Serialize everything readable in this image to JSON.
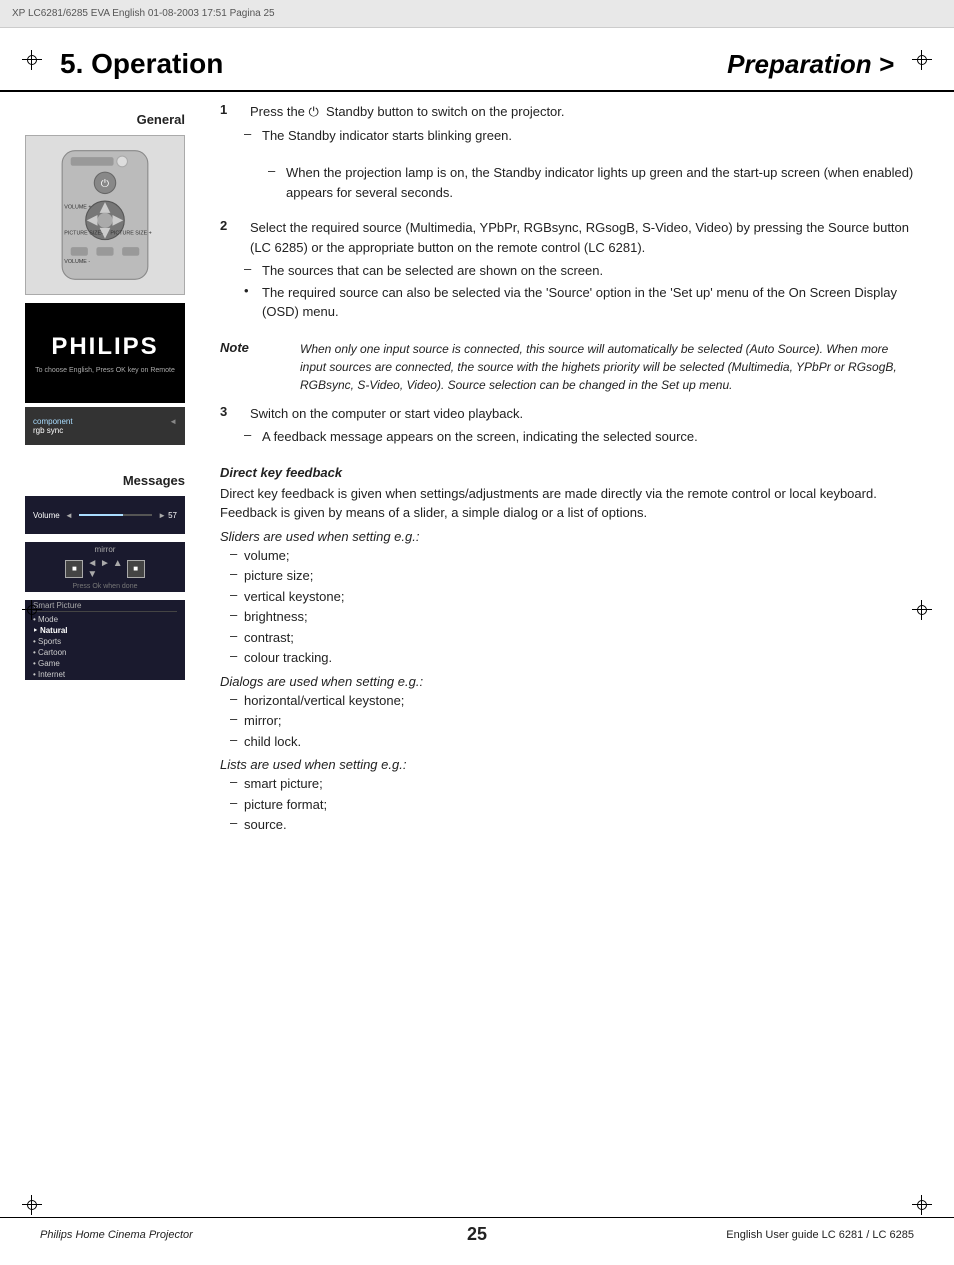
{
  "header": {
    "meta_text": "XP LC6281/6285 EVA English 01-08-2003  17:51  Pagina 25"
  },
  "title": {
    "chapter": "5. Operation",
    "section": "Preparation >"
  },
  "sidebar": {
    "general_label": "General",
    "philips_logo": "PHILIPS",
    "philips_subtitle": "To choose English, Press OK key on Remote",
    "messages_label": "Messages",
    "slider_label": "Volume",
    "slider_value": "57"
  },
  "content": {
    "step1": {
      "number": "1",
      "text": "Press the ⏻  Standby button to switch on the projector.",
      "dash1": "The Standby indicator starts blinking green."
    },
    "note_spacer": "When the projection lamp is on, the Standby indicator lights up green and the start-up screen (when enabled) appears for several seconds.",
    "step2": {
      "number": "2",
      "text": "Select the required source (Multimedia, YPbPr, RGBsync, RGsogB, S-Video, Video) by pressing the Source button (LC 6285) or the appropriate button on the remote control (LC 6281).",
      "dash1": "The sources that can be selected are shown on the screen.",
      "bullet1": "The required source can also be selected via the 'Source' option in the 'Set up' menu of the On Screen Display (OSD) menu."
    },
    "note": {
      "label": "Note",
      "text": "When only one input source is connected, this source will automatically be selected (Auto Source). When more input sources are connected, the source with the highets priority will be selected (Multimedia, YPbPr or RGsogB, RGBsync, S-Video, Video). Source selection can be changed in the Set up menu."
    },
    "step3": {
      "number": "3",
      "text": "Switch on the computer or start video playback.",
      "dash1": "A feedback message appears on the screen, indicating the selected source."
    },
    "messages_heading": "Direct key feedback",
    "messages_intro": "Direct key feedback is given when settings/adjustments are made directly via the remote control or local keyboard. Feedback is given by means of a slider, a simple dialog or a list of options.",
    "sliders_intro": "Sliders are used when setting e.g.:",
    "sliders": [
      "volume;",
      "picture size;",
      "vertical keystone;",
      "brightness;",
      "contrast;",
      "colour tracking."
    ],
    "dialogs_intro": "Dialogs are used when setting e.g.:",
    "dialogs": [
      "horizontal/vertical keystone;",
      "mirror;",
      "child lock."
    ],
    "lists_intro": "Lists are used when setting e.g.:",
    "lists": [
      "smart picture;",
      "picture format;",
      "source."
    ]
  },
  "footer": {
    "left": "Philips Home Cinema Projector",
    "center": "25",
    "right": "English  User guide   LC 6281 / LC 6285"
  }
}
